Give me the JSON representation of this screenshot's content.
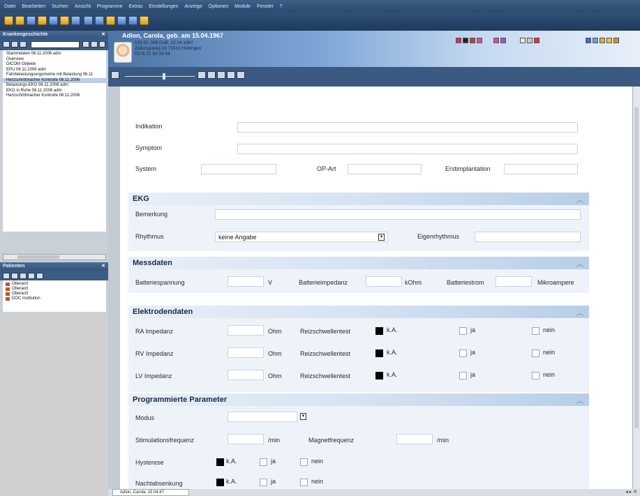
{
  "menu": [
    "Datei",
    "Bearbeiten",
    "Suchen",
    "Ansicht",
    "Programme",
    "Extras",
    "Einstellungen",
    "Anzeige",
    "Optionen",
    "Module",
    "Fenster",
    "?"
  ],
  "left": {
    "history_title": "Krankengeschichte",
    "history_items": [
      "Stammdaten 06.11.2006 adm",
      "Overview",
      "DICOM Objekte",
      "EPU 06.11.2006 adm",
      "Fahrbelastungsergometrie mit Belastung 06.11",
      "Herzschrittmacher Kontrolle 06.11.2006",
      "Belastungs-EKG 06.11.2006 adm",
      "EKG in Ruhe 06.11.2006 adm",
      "Herzschrittmacher Kontrolle 06.11.2006"
    ],
    "selected_index": 5,
    "persons_title": "Patienten",
    "persons": [
      "Oberarzt",
      "Oberarzt",
      "Oberarzt",
      "DOC Institution"
    ]
  },
  "patient": {
    "name": "Adlon, Carola, geb. am 15.04.1967",
    "line1": "KIS ID: 396 DoB: 15.04.1967",
    "line2": "Zeitungsweg 19 71513 Hüttingen",
    "line3": "0178 21 60 08 54"
  },
  "form": {
    "indikation": "Indikation",
    "symptom": "Symptom",
    "system": "System",
    "op_art": "OP-Art",
    "erstimplantation": "Erstimplantation",
    "ekg": {
      "title": "EKG",
      "bemerkung": "Bemerkung",
      "rhythmus": "Rhythmus",
      "rhythmus_value": "keine Angabe",
      "eigenrhythmus": "Eigenrhythmus"
    },
    "messdaten": {
      "title": "Messdaten",
      "batteriespannung": "Batteriespannung",
      "unit_v": "V",
      "batterieimpedanz": "Batterieimpedanz",
      "unit_kohm": "kOhm",
      "batteriestrom": "Batteriestrom",
      "unit_ma": "Mikroampere"
    },
    "elektroden": {
      "title": "Elektrodendaten",
      "rows": [
        {
          "label": "RA Impedanz",
          "unit": "Ohm",
          "test": "Reizschwellentest",
          "ka": "k.A.",
          "ja": "ja",
          "nein": "nein"
        },
        {
          "label": "RV Impedanz",
          "unit": "Ohm",
          "test": "Reizschwellentest",
          "ka": "k.A.",
          "ja": "ja",
          "nein": "nein"
        },
        {
          "label": "LV Impedanz",
          "unit": "Ohm",
          "test": "Reizschwellentest",
          "ka": "k.A.",
          "ja": "ja",
          "nein": "nein"
        }
      ]
    },
    "parameter": {
      "title": "Programmierte Parameter",
      "modus": "Modus",
      "stimulationsfrequenz": "Stimulationsfrequenz",
      "unit_min": "/min",
      "magnetfrequenz": "Magnetfrequenz",
      "unit_min2": "/min",
      "hysterese": "Hysterese",
      "nachtabsenkung": "Nachtabsenkung",
      "ka": "k.A.",
      "ja": "ja",
      "nein": "nein"
    }
  },
  "bottom_tab": "Adlon, Carola, 15.04.67",
  "colors": {
    "header_blue": "#3a5a82",
    "section_gradient_end": "#b7cee8"
  }
}
